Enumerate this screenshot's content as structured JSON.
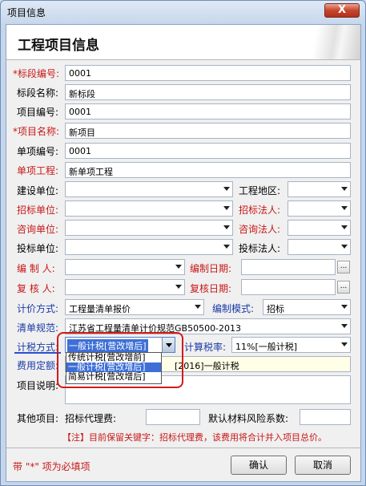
{
  "window": {
    "title": "项目信息",
    "close_glyph": "X"
  },
  "header": {
    "title": "工程项目信息"
  },
  "fields": {
    "section_no": {
      "label": "*标段编号:",
      "value": "0001"
    },
    "section_name": {
      "label": "标段名称:",
      "value": "新标段"
    },
    "project_no": {
      "label": "项目编号:",
      "value": "0001"
    },
    "project_name": {
      "label": "*项目名称:",
      "value": "新项目"
    },
    "item_no": {
      "label": "单项编号:",
      "value": "0001"
    },
    "item_project": {
      "label": "单项工程:",
      "value": "新单项工程"
    },
    "build_unit": {
      "label": "建设单位:",
      "value": ""
    },
    "project_area": {
      "label": "工程地区:",
      "value": ""
    },
    "tender_unit": {
      "label": "招标单位:",
      "value": ""
    },
    "tender_legal": {
      "label": "招标法人:",
      "value": ""
    },
    "consult_unit": {
      "label": "咨询单位:",
      "value": ""
    },
    "consult_legal": {
      "label": "咨询法人:",
      "value": ""
    },
    "bid_unit": {
      "label": "投标单位:",
      "value": ""
    },
    "bid_legal": {
      "label": "投标法人:",
      "value": ""
    },
    "compiler": {
      "label": "编 制 人:",
      "value": ""
    },
    "compile_date": {
      "label": "编制日期:",
      "value": ""
    },
    "reviewer": {
      "label": "复 核 人:",
      "value": ""
    },
    "review_date": {
      "label": "复核日期:",
      "value": ""
    },
    "pricing_method": {
      "label": "计价方式:",
      "value": "工程量清单报价"
    },
    "compile_mode": {
      "label": "编制模式:",
      "value": "招标"
    },
    "spec": {
      "label": "清单规范:",
      "value": "江苏省工程量清单计价规范GB50500-2013"
    },
    "tax_method": {
      "label": "计税方式:",
      "value": "一般计税[营改增后]"
    },
    "tax_rate": {
      "label": "计算税率:",
      "value": "11%[一般计税]"
    },
    "quota": {
      "label": "费用定额:",
      "value": "[2016]一般计税"
    },
    "description": {
      "label": "项目说明:",
      "value": ""
    },
    "other_items": {
      "label": "其他项目:"
    },
    "agency_fee": {
      "label": "招标代理费:",
      "value": ""
    },
    "risk_coef": {
      "label": "默认材料风险系数:",
      "value": ""
    }
  },
  "tax_options": [
    "传统计税[营改增前]",
    "一般计税[营改增后]",
    "简易计税[营改增后]"
  ],
  "tax_selected_index": 1,
  "note": "【注】目前保留关键字：招标代理费，该费用将合计并入项目总价。",
  "footer": {
    "required_hint": "带 \"*\" 项为必填项",
    "ok_label": "确认",
    "cancel_label": "取消"
  },
  "date_button_glyph": "..."
}
